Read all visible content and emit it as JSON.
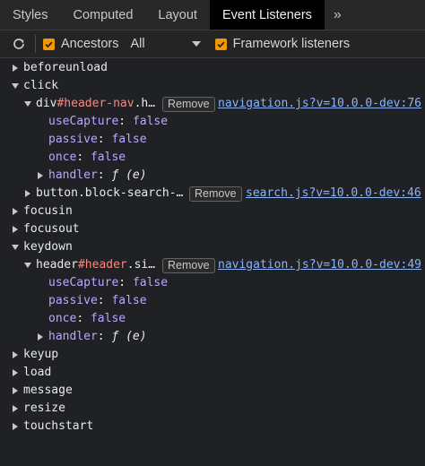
{
  "tabs": [
    {
      "label": "Styles"
    },
    {
      "label": "Computed"
    },
    {
      "label": "Layout"
    },
    {
      "label": "Event Listeners",
      "active": true
    }
  ],
  "more_tabs_label": "»",
  "toolbar": {
    "ancestors_label": "Ancestors",
    "ancestors_checked": true,
    "filter_value": "All",
    "framework_label": "Framework listeners",
    "framework_checked": true
  },
  "events": [
    {
      "name": "beforeunload",
      "expanded": false
    },
    {
      "name": "click",
      "expanded": true,
      "listeners": [
        {
          "tag": "div",
          "id": "#header-nav",
          "rest": ".h…",
          "expanded": true,
          "remove_label": "Remove",
          "source": "navigation.js?v=10.0.0-dev:76",
          "props": [
            {
              "key": "useCapture",
              "value": "false"
            },
            {
              "key": "passive",
              "value": "false"
            },
            {
              "key": "once",
              "value": "false"
            }
          ],
          "handler": {
            "key": "handler",
            "value": "ƒ (e)"
          }
        },
        {
          "tag": "button",
          "id": "",
          "rest": ".block-search-…",
          "expanded": false,
          "remove_label": "Remove",
          "source": "search.js?v=10.0.0-dev:46"
        }
      ]
    },
    {
      "name": "focusin",
      "expanded": false
    },
    {
      "name": "focusout",
      "expanded": false
    },
    {
      "name": "keydown",
      "expanded": true,
      "listeners": [
        {
          "tag": "header",
          "id": "#header",
          "rest": ".si…",
          "expanded": true,
          "remove_label": "Remove",
          "source": "navigation.js?v=10.0.0-dev:49",
          "props": [
            {
              "key": "useCapture",
              "value": "false"
            },
            {
              "key": "passive",
              "value": "false"
            },
            {
              "key": "once",
              "value": "false"
            }
          ],
          "handler": {
            "key": "handler",
            "value": "ƒ (e)"
          }
        }
      ]
    },
    {
      "name": "keyup",
      "expanded": false
    },
    {
      "name": "load",
      "expanded": false
    },
    {
      "name": "message",
      "expanded": false
    },
    {
      "name": "resize",
      "expanded": false
    },
    {
      "name": "touchstart",
      "expanded": false
    }
  ],
  "colors": {
    "background": "#202124",
    "checkbox": "#f29900",
    "link": "#8ab4f8",
    "property": "#b8a9ff",
    "element_id": "#f28b82"
  }
}
